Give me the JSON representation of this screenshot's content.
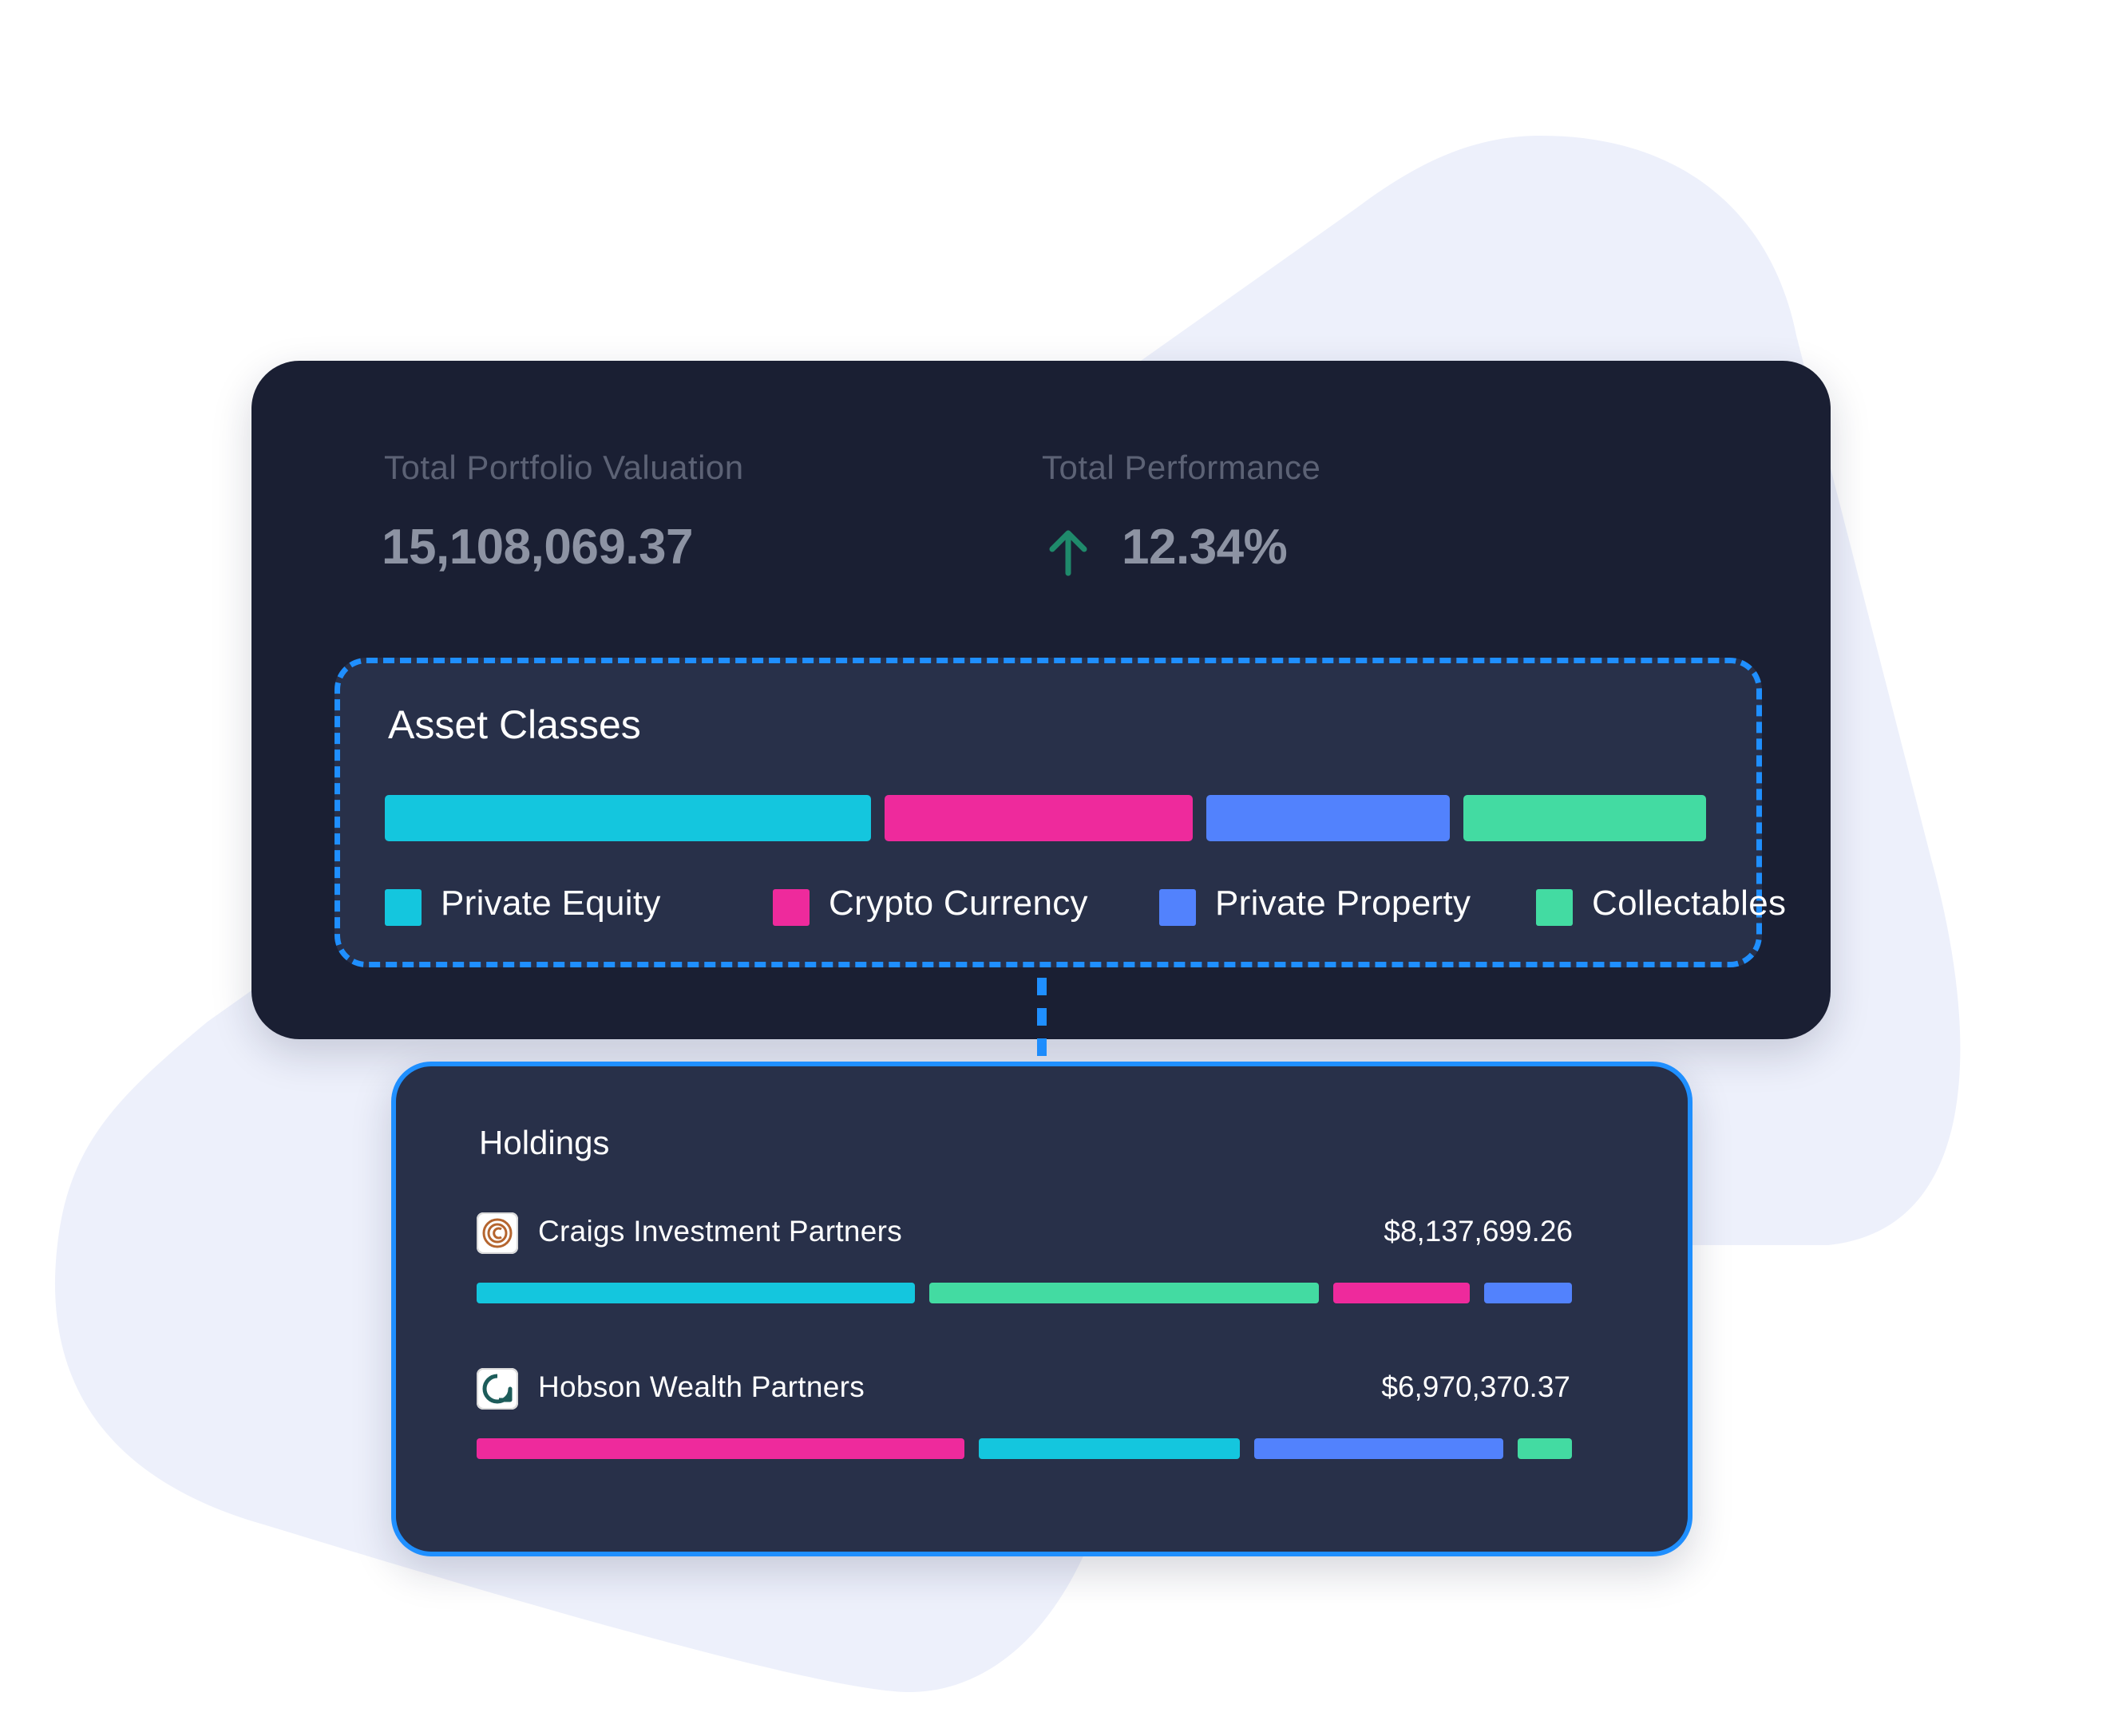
{
  "colors": {
    "private_equity": "#14c6de",
    "crypto_currency": "#ee2a9c",
    "private_property": "#5282fd",
    "collectables": "#43dba2",
    "accent_blue": "#1f8fff",
    "card_dark": "#1a1f33",
    "card_navy": "#283049",
    "performance_up": "#1f8a6b"
  },
  "summary": {
    "valuation_label": "Total Portfolio Valuation",
    "valuation_value": "15,108,069.37",
    "performance_label": "Total Performance",
    "performance_value": "12.34%",
    "performance_direction": "up",
    "performance_icon": "arrow-up-icon"
  },
  "asset_classes": {
    "title": "Asset Classes",
    "items": [
      {
        "label": "Private Equity",
        "color": "#14c6de",
        "share": 0.37
      },
      {
        "label": "Crypto Currency",
        "color": "#ee2a9c",
        "share": 0.235
      },
      {
        "label": "Private Property",
        "color": "#5282fd",
        "share": 0.185
      },
      {
        "label": "Collectables",
        "color": "#43dba2",
        "share": 0.185
      }
    ]
  },
  "holdings": {
    "title": "Holdings",
    "items": [
      {
        "name": "Craigs Investment Partners",
        "value": "$8,137,699.26",
        "logo": "craigs-logo-icon",
        "allocation": [
          {
            "asset": "Private Equity",
            "share": 0.4
          },
          {
            "asset": "Collectables",
            "share": 0.355
          },
          {
            "asset": "Crypto Currency",
            "share": 0.125
          },
          {
            "asset": "Private Property",
            "share": 0.08
          }
        ]
      },
      {
        "name": "Hobson Wealth Partners",
        "value": "$6,970,370.37",
        "logo": "hobson-logo-icon",
        "allocation": [
          {
            "asset": "Crypto Currency",
            "share": 0.45
          },
          {
            "asset": "Private Equity",
            "share": 0.24
          },
          {
            "asset": "Private Property",
            "share": 0.23
          },
          {
            "asset": "Collectables",
            "share": 0.05
          }
        ]
      }
    ]
  }
}
